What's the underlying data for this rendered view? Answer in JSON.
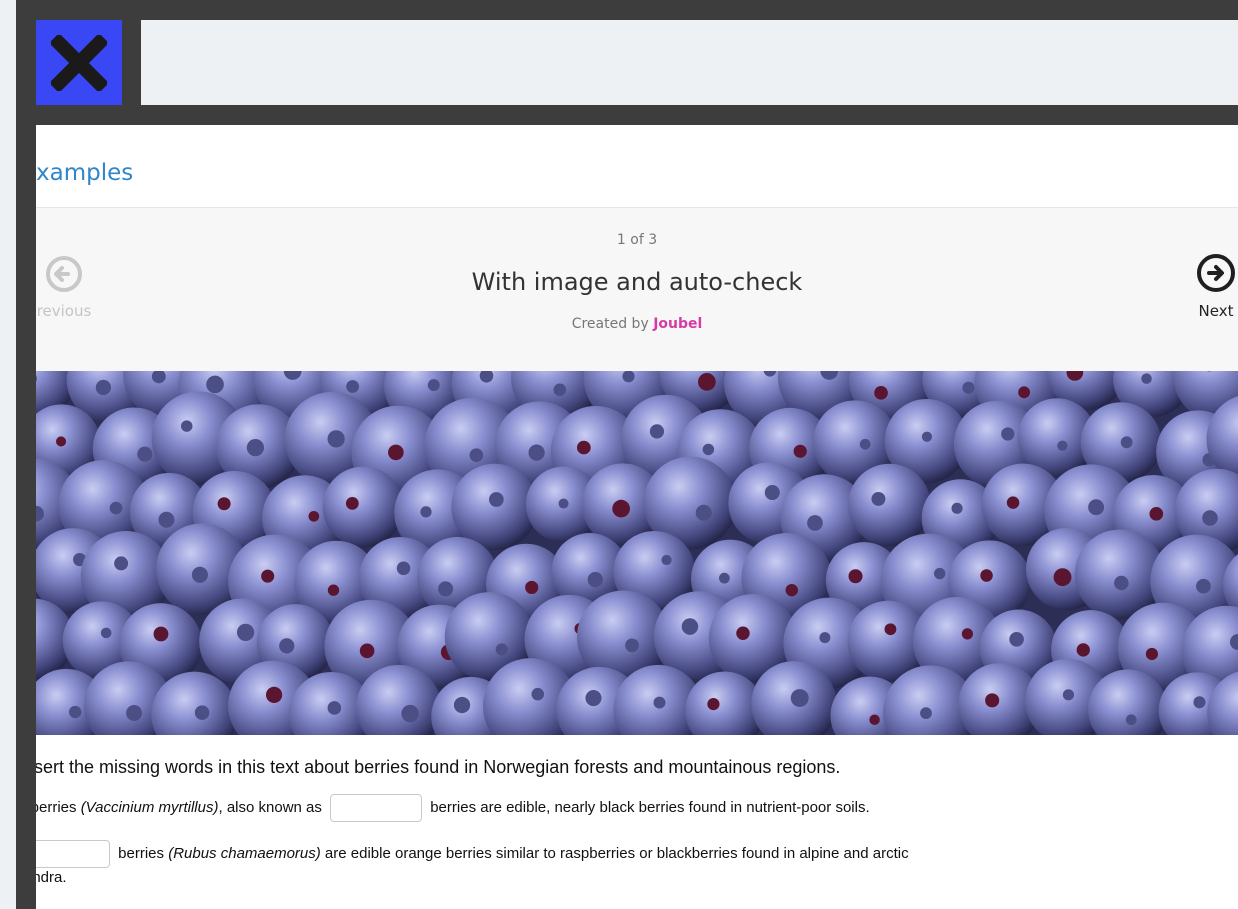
{
  "page": {
    "heading": "xamples"
  },
  "navigation": {
    "counter": "1 of 3",
    "previous_label": "revious",
    "next_label": "Next"
  },
  "content": {
    "title": "With image and auto-check",
    "created_by_prefix": "Created by",
    "author": "Joubel",
    "image_alt": "blueberries"
  },
  "exercise": {
    "intro": "nsert the missing words in this text about berries found in Norwegian forests and mountainous regions.",
    "sentence1": {
      "before": "ilberries ",
      "latin": "(Vaccinium myrtillus)",
      "middle": ", also known as",
      "blank_value": "",
      "after": "berries are edible, nearly black berries found in nutrient-poor soils."
    },
    "sentence2": {
      "blank_value": "",
      "before": "berries ",
      "latin": "(Rubus chamaemorus)",
      "after": " are edible orange berries similar to raspberries or blackberries found in alpine and arctic",
      "continuation": "undra."
    }
  },
  "colors": {
    "close_button": "#3a47f5",
    "heading": "#2f86c9",
    "author_link": "#d63aa6"
  }
}
